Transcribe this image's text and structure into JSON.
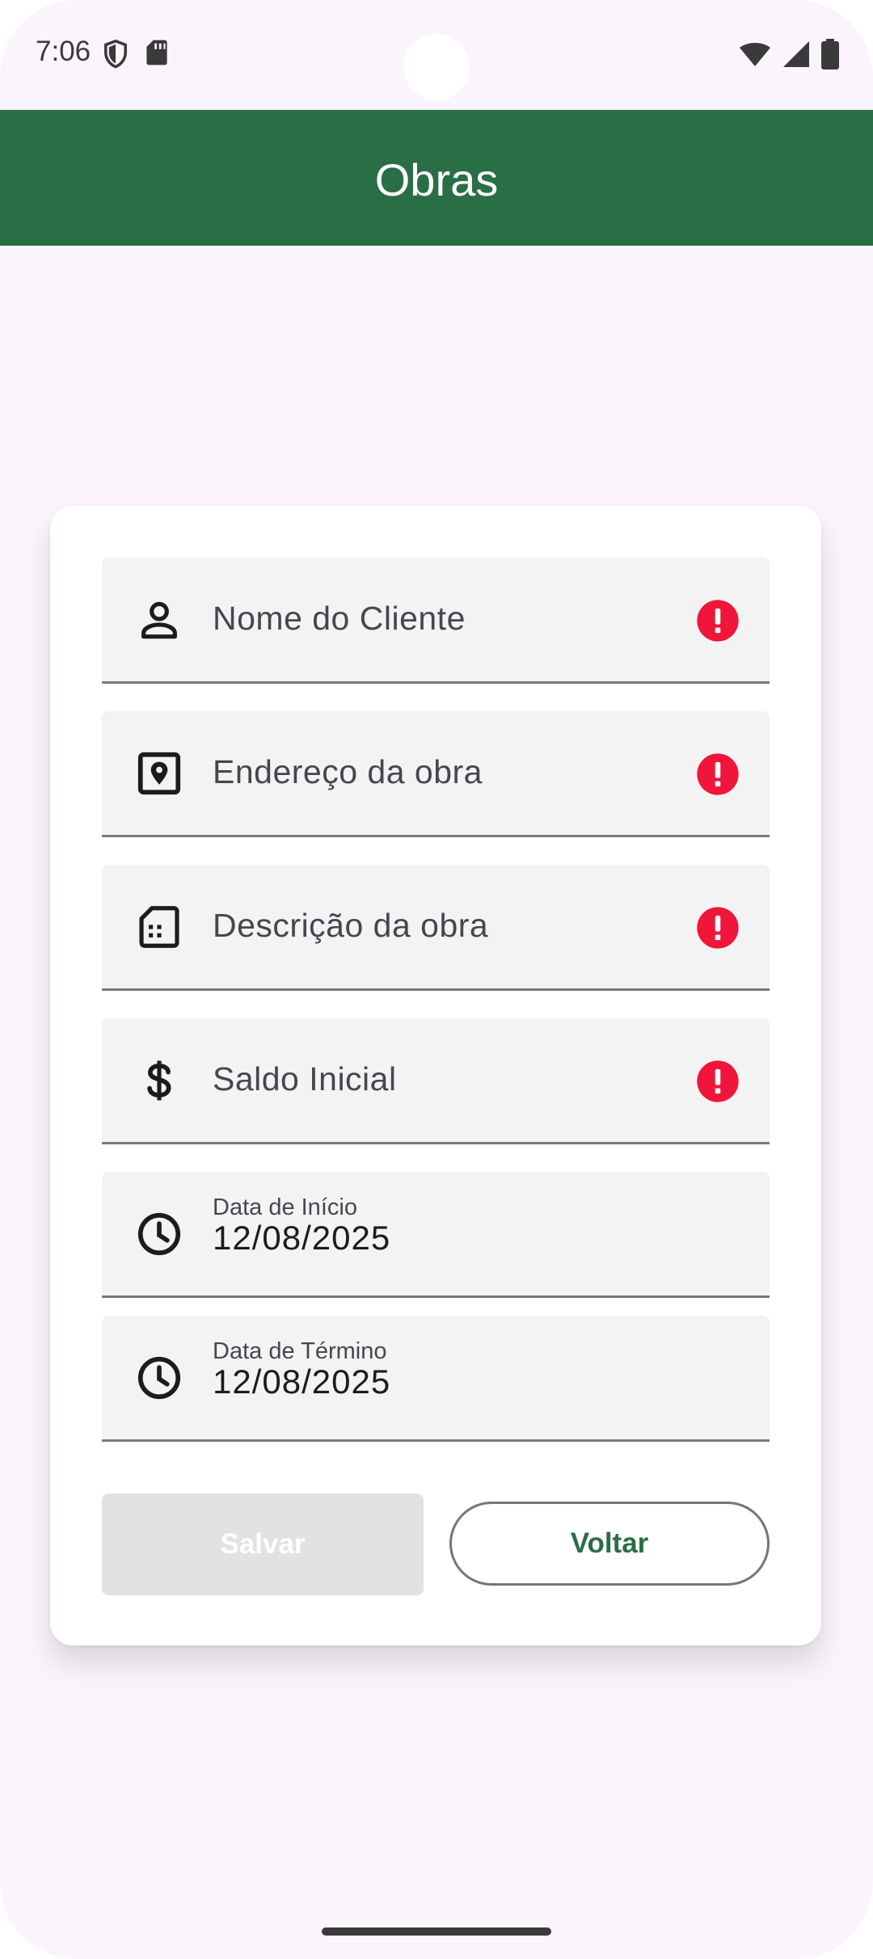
{
  "status_bar": {
    "time": "7:06",
    "left_icons": [
      "shield-icon",
      "sd-card-icon"
    ],
    "right_icons": [
      "wifi-icon",
      "signal-icon",
      "battery-icon"
    ]
  },
  "app_bar": {
    "title": "Obras",
    "background_color": "#2a6e46"
  },
  "form": {
    "fields": [
      {
        "icon": "person-icon",
        "placeholder": "Nome do Cliente",
        "error": true
      },
      {
        "icon": "location-pin-icon",
        "placeholder": "Endereço da obra",
        "error": true
      },
      {
        "icon": "description-icon",
        "placeholder": "Descrição da obra",
        "error": true
      },
      {
        "icon": "dollar-icon",
        "placeholder": "Saldo Inicial",
        "error": true
      }
    ],
    "start_date": {
      "icon": "clock-icon",
      "label": "Data de Início",
      "value": "12/08/2025"
    },
    "end_date": {
      "icon": "clock-icon",
      "label": "Data de Término",
      "value": "12/08/2025"
    },
    "error_color": "#f0153a",
    "save_label": "Salvar",
    "save_enabled": false,
    "back_label": "Voltar",
    "accent_color": "#2a6e46"
  }
}
